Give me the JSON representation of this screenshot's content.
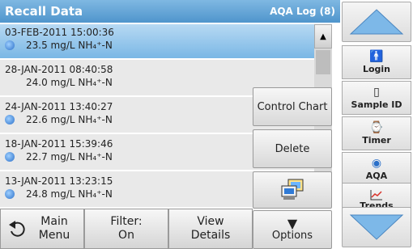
{
  "header": {
    "title": "Recall Data",
    "log_label": "AQA Log (8)"
  },
  "rows": [
    {
      "date": "03-FEB-2011  15:00:36",
      "value": "23.5  mg/L  NH₄⁺-N"
    },
    {
      "date": "28-JAN-2011  08:40:58",
      "value": "24.0  mg/L  NH₄⁺-N"
    },
    {
      "date": "24-JAN-2011  13:40:27",
      "value": "22.6  mg/L  NH₄⁺-N"
    },
    {
      "date": "18-JAN-2011  15:39:46",
      "value": "22.7  mg/L  NH₄⁺-N"
    },
    {
      "date": "13-JAN-2011  13:23:15",
      "value": "24.8  mg/L  NH₄⁺-N"
    }
  ],
  "popup": {
    "control_chart": "Control Chart",
    "delete": "Delete",
    "options": "Options"
  },
  "sidebar": {
    "login": "Login",
    "sample_id": "Sample ID",
    "timer": "Timer",
    "aqa": "AQA",
    "trends": "Trends"
  },
  "bottom": {
    "main_menu": "Main Menu",
    "filter": "Filter: On",
    "view_details": "View Details"
  },
  "icons": {
    "selected_row": "sample-bottle-icon",
    "login": "person-icon",
    "sample_id": "bottle-icon",
    "timer": "timer-icon",
    "aqa": "aqa-icon",
    "trends": "trends-icon",
    "computer": "computer-icon"
  },
  "colors": {
    "accent": "#4f95cc",
    "selected_row": "#7ab7e5"
  }
}
